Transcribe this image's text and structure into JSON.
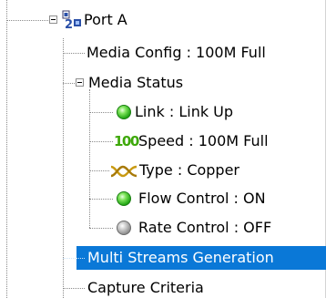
{
  "tree": {
    "port": {
      "label": "Port A",
      "icon": "network-port-icon"
    },
    "media_config": {
      "label": "Media Config : 100M Full"
    },
    "media_status": {
      "label": "Media Status",
      "children": {
        "link": {
          "label": "Link : Link Up",
          "icon": "green-led-icon"
        },
        "speed": {
          "label": "Speed : 100M Full",
          "icon": "speed-100-icon",
          "badge": "100"
        },
        "type": {
          "label": "Type : Copper",
          "icon": "copper-cable-icon"
        },
        "flow_control": {
          "label": "Flow Control : ON",
          "icon": "green-led-icon"
        },
        "rate_control": {
          "label": "Rate Control : OFF",
          "icon": "gray-led-icon"
        }
      }
    },
    "multi_streams": {
      "label": "Multi Streams Generation",
      "selected": true
    },
    "capture_criteria": {
      "label": "Capture Criteria"
    }
  },
  "colors": {
    "selection": "#0a78d7",
    "led_green": "#24a816",
    "led_gray": "#8a8a8a",
    "speed_badge": "#3ea80a",
    "copper_icon": "#c99a12"
  }
}
